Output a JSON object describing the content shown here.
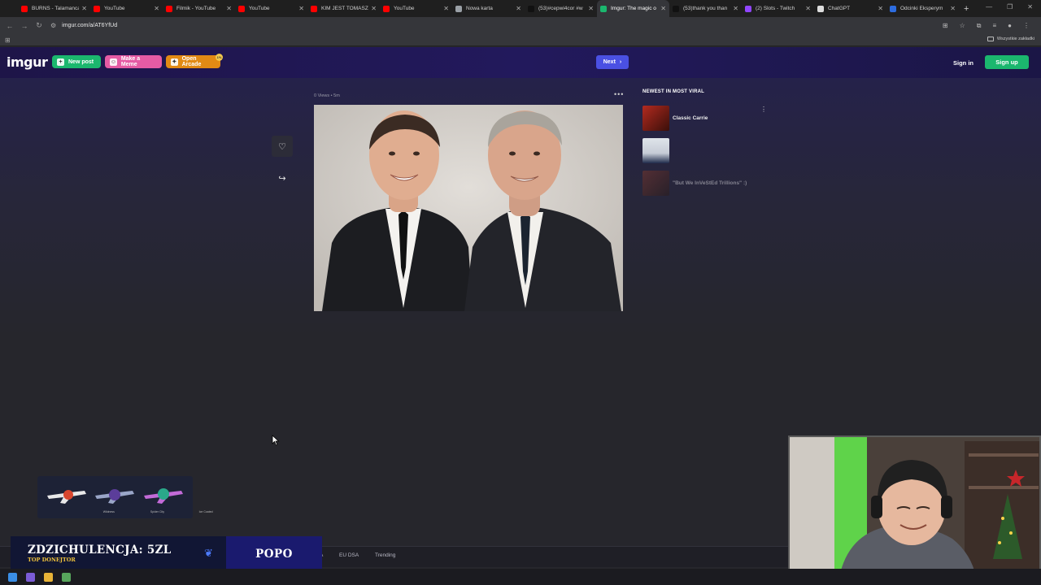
{
  "browser": {
    "tabs": [
      {
        "title": "BURNS - Talamanca",
        "color": "#ff0000"
      },
      {
        "title": "YouTube",
        "color": "#ff0000"
      },
      {
        "title": "Filmik - YouTube",
        "color": "#ff0000"
      },
      {
        "title": "YouTube",
        "color": "#ff0000"
      },
      {
        "title": "KIM JEST TOMASZ",
        "color": "#ff0000"
      },
      {
        "title": "YouTube",
        "color": "#ff0000"
      },
      {
        "title": "Nowa karta",
        "color": "#9aa0a6"
      },
      {
        "title": "(53)#cepwi4cor #w",
        "color": "#111111"
      },
      {
        "title": "Imgur: The magic o",
        "color": "#1bb76e"
      },
      {
        "title": "(53)thank you than",
        "color": "#111111"
      },
      {
        "title": "(2) Slots - Twitch",
        "color": "#9146ff"
      },
      {
        "title": "ChatGPT",
        "color": "#dddddd"
      },
      {
        "title": "Odcinki Eksperym",
        "color": "#2d6cdf"
      }
    ],
    "active_tab_index": 8,
    "url": "imgur.com/a/AT6YfUd",
    "all_bookmarks_label": "Wszystkie zakładki"
  },
  "imgur_header": {
    "logo": "imgur",
    "new_post": "New post",
    "make_meme": "Make a Meme",
    "open_arcade": "Open Arcade",
    "arcade_badge": "1%",
    "next": "Next",
    "sign_in": "Sign in",
    "sign_up": "Sign up"
  },
  "post": {
    "meta": "0 Views • 5m",
    "more": "•••"
  },
  "viral": {
    "heading": "NEWEST IN MOST VIRAL",
    "items": [
      {
        "title": "Classic Carrie"
      },
      {
        "title": ""
      },
      {
        "title": "\"But We InVeStEd Trillions\" :)"
      }
    ]
  },
  "footer": {
    "links": [
      "A",
      "EU DSA",
      "Trending"
    ]
  },
  "overlay": {
    "donation_line": "ZDZICHULENCJA: 5ZL",
    "donation_sub": "TOP DONEJTOR",
    "popo": "POPO",
    "weapons": [
      {
        "caption": "Wildness"
      },
      {
        "caption": "Spider City"
      },
      {
        "caption": "Ice Coated"
      }
    ]
  },
  "colors": {
    "header_bg": "#1e1548",
    "green": "#1bb76e",
    "pink": "#e55ba4",
    "orange": "#e28a14",
    "next_blue": "#4a50e3"
  }
}
